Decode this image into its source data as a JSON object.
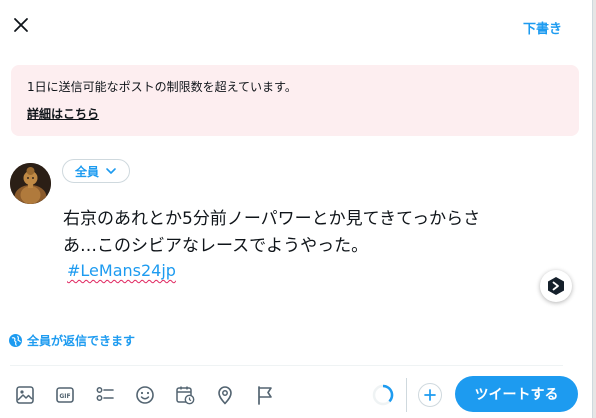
{
  "header": {
    "close_icon": "close-icon",
    "drafts_label": "下書き"
  },
  "alert": {
    "message": "1日に送信可能なポストの制限数を超えています。",
    "link_label": "詳細はこちら"
  },
  "composer": {
    "avatar_icon": "avatar",
    "audience_label": "全員",
    "text_lines": [
      "右京のあれとか5分前ノーパワーとか見てきてっからさ",
      "あ…このシビアなレースでようやった。"
    ],
    "hashtag": "#LeMans24jp",
    "reply_setting_label": "全員が返信できます"
  },
  "toolbar": {
    "icons": [
      "image-icon",
      "gif-icon",
      "poll-icon",
      "emoji-icon",
      "schedule-icon",
      "location-icon",
      "flag-icon"
    ],
    "gif_text": "GIF",
    "tweet_label": "ツイートする"
  },
  "colors": {
    "accent": "#1d9bf0",
    "alert_background": "#fdeef0",
    "text": "#0f1419"
  }
}
